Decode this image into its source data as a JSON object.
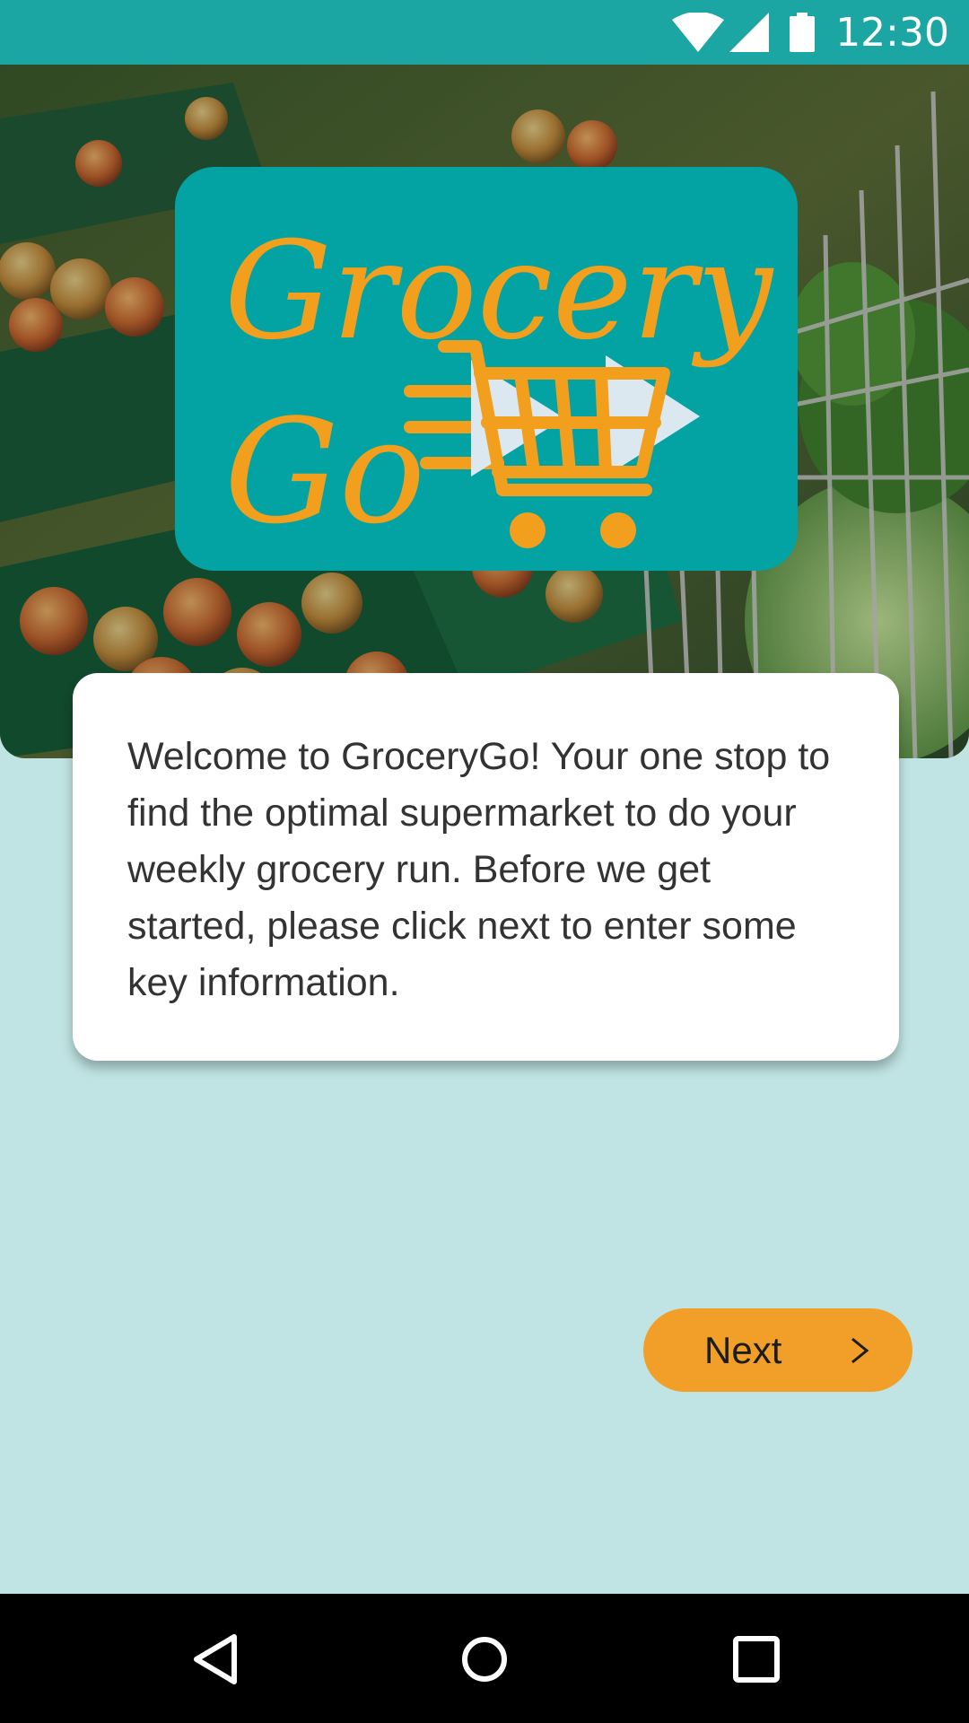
{
  "status_bar": {
    "time": "12:30",
    "icons": [
      "wifi-icon",
      "cell-signal-icon",
      "battery-icon"
    ],
    "color": "#1ba6a3"
  },
  "hero": {
    "image": "supermarket produce shelves with shopping cart",
    "logo": {
      "text": "GroceryGo",
      "background": "#04a3a3",
      "accent": "#f29f1e"
    }
  },
  "welcome_card": {
    "text": "Welcome to GroceryGo! Your one stop to find the optimal supermarket to do your weekly grocery run. Before we get started, please click next to enter some key information."
  },
  "next_button": {
    "label": "Next",
    "icon": "chevron-right-icon",
    "color": "#f29f2a"
  },
  "nav_bar": {
    "buttons": [
      "back-icon",
      "home-icon",
      "recents-icon"
    ]
  },
  "colors": {
    "page_background": "#bfe4e3"
  }
}
